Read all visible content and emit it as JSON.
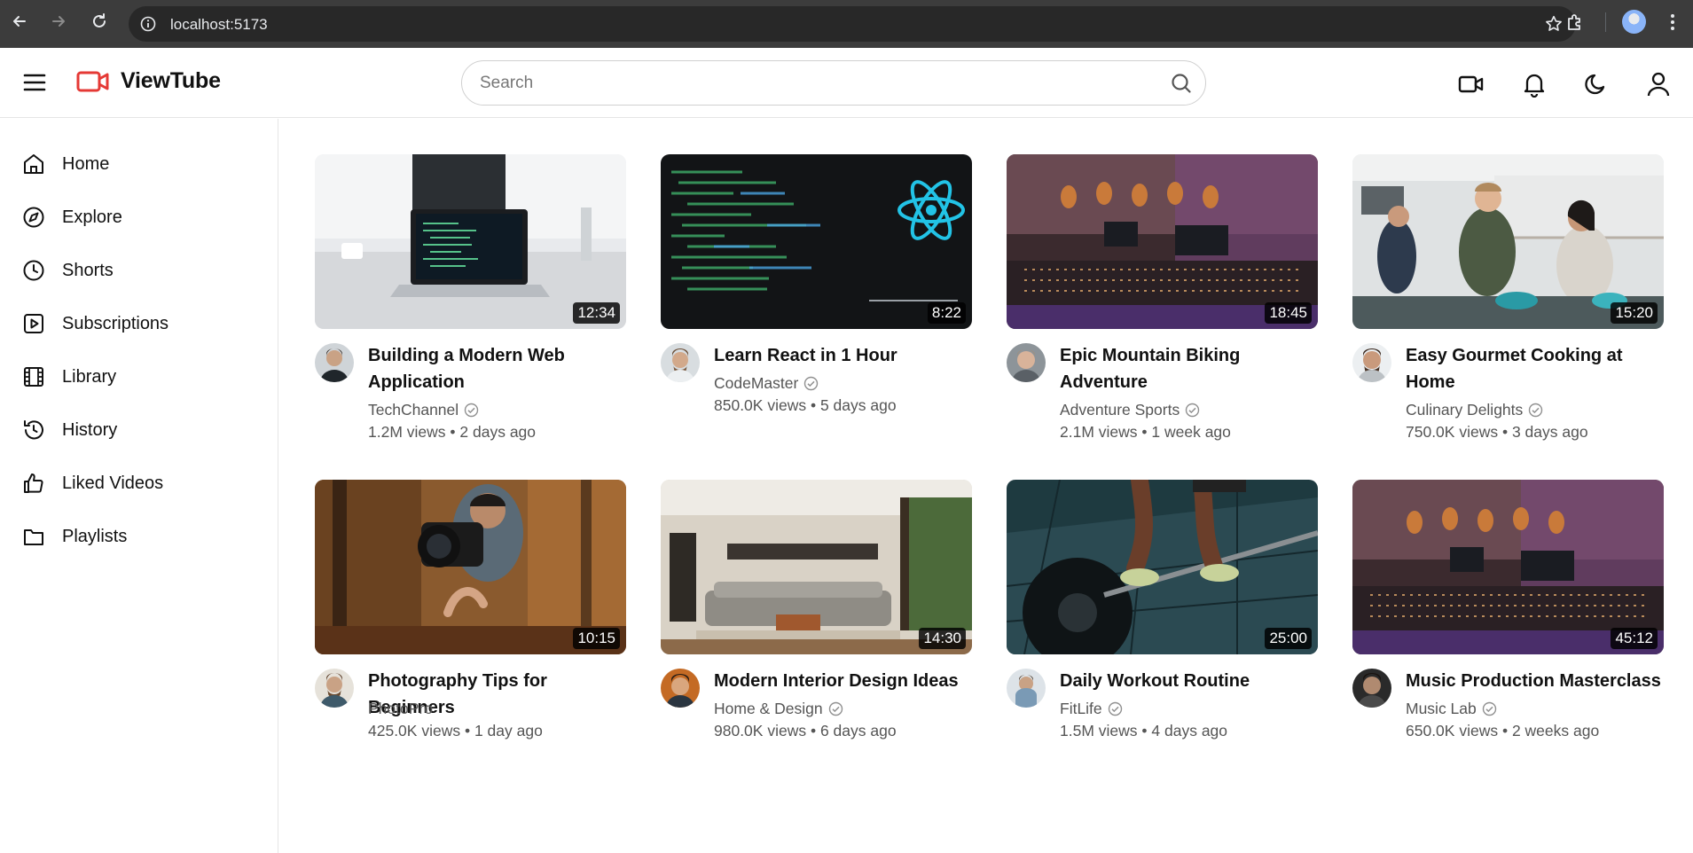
{
  "browser": {
    "url": "localhost:5173",
    "icons": [
      "back-icon",
      "forward-icon",
      "reload-icon",
      "site-info-icon",
      "bookmark-star-icon",
      "extensions-icon",
      "profile-avatar",
      "browser-menu-icon"
    ]
  },
  "header": {
    "app_name": "ViewTube",
    "search_placeholder": "Search",
    "icons": [
      "menu-icon",
      "logo-video-icon",
      "search-icon",
      "create-video-icon",
      "notifications-bell-icon",
      "dark-mode-moon-icon",
      "account-user-icon"
    ],
    "brand_color": "#e53935"
  },
  "sidebar": {
    "items": [
      {
        "label": "Home",
        "icon": "home-icon"
      },
      {
        "label": "Explore",
        "icon": "compass-icon"
      },
      {
        "label": "Shorts",
        "icon": "clock-icon"
      },
      {
        "label": "Subscriptions",
        "icon": "play-square-icon"
      },
      {
        "label": "Library",
        "icon": "film-icon"
      },
      {
        "label": "History",
        "icon": "history-icon"
      },
      {
        "label": "Liked Videos",
        "icon": "thumbs-up-icon"
      },
      {
        "label": "Playlists",
        "icon": "folder-icon"
      }
    ]
  },
  "videos": [
    {
      "title": "Building a Modern Web Application",
      "channel": "TechChannel",
      "verified": true,
      "views": "1.2M views",
      "age": "2 days ago",
      "duration": "12:34"
    },
    {
      "title": "Learn React in 1 Hour",
      "channel": "CodeMaster",
      "verified": true,
      "views": "850.0K views",
      "age": "5 days ago",
      "duration": "8:22"
    },
    {
      "title": "Epic Mountain Biking Adventure",
      "channel": "Adventure Sports",
      "verified": true,
      "views": "2.1M views",
      "age": "1 week ago",
      "duration": "18:45"
    },
    {
      "title": "Easy Gourmet Cooking at Home",
      "channel": "Culinary Delights",
      "verified": true,
      "views": "750.0K views",
      "age": "3 days ago",
      "duration": "15:20"
    },
    {
      "title": "Photography Tips for Beginners",
      "channel": "PhotoPro",
      "verified": false,
      "views": "425.0K views",
      "age": "1 day ago",
      "duration": "10:15"
    },
    {
      "title": "Modern Interior Design Ideas",
      "channel": "Home & Design",
      "verified": true,
      "views": "980.0K views",
      "age": "6 days ago",
      "duration": "14:30"
    },
    {
      "title": "Daily Workout Routine",
      "channel": "FitLife",
      "verified": true,
      "views": "1.5M views",
      "age": "4 days ago",
      "duration": "25:00"
    },
    {
      "title": "Music Production Masterclass",
      "channel": "Music Lab",
      "verified": true,
      "views": "650.0K views",
      "age": "2 weeks ago",
      "duration": "45:12"
    }
  ]
}
